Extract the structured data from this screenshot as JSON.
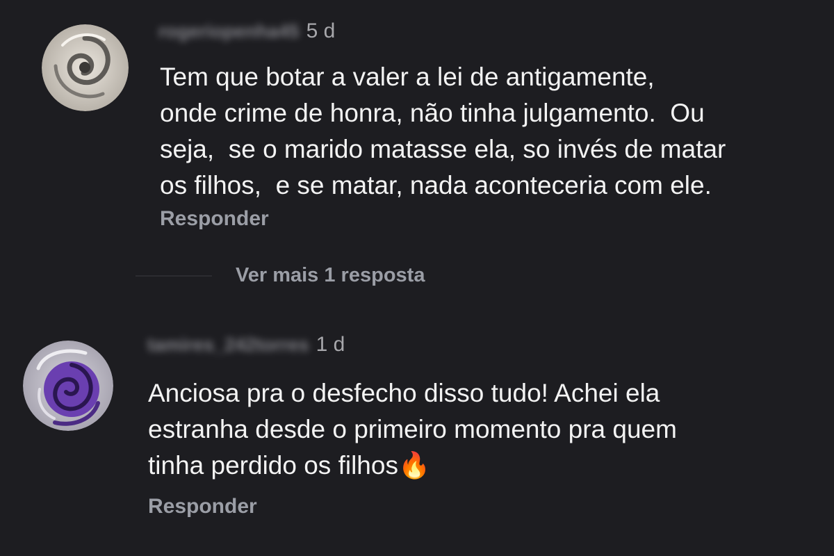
{
  "comments": [
    {
      "username": "rogeriopenha45",
      "time": "5 d",
      "text": "Tem que botar a valer a lei de antigamente,\nonde crime de honra, não tinha julgamento.  Ou\nseja,  se o marido matasse ela, so invés de matar\nos filhos,  e se matar, nada aconteceria com ele.",
      "reply_label": "Responder",
      "avatar_icon": "swirl-avatar-grey"
    },
    {
      "username": "tamires_242torres",
      "time": "1 d",
      "text": "Anciosa pra o desfecho disso tudo! Achei ela\nestranha desde o primeiro momento pra quem\ntinha perdido os filhos",
      "emoji": "🔥",
      "reply_label": "Responder",
      "avatar_icon": "swirl-avatar-purple"
    }
  ],
  "more_replies_label": "Ver mais 1 resposta",
  "colors": {
    "background": "#1d1d21",
    "text": "#f3f3f3",
    "secondary": "#9b9ea6",
    "avatar_purple": "#6a3fb0"
  }
}
